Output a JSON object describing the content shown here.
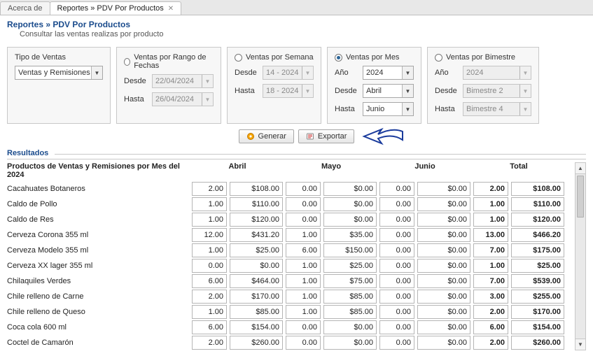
{
  "tabs": {
    "inactive": "Acerca de",
    "active": "Reportes » PDV Por Productos"
  },
  "title": {
    "crumb": "Reportes » PDV Por Productos",
    "sub": "Consultar las ventas realizas por producto"
  },
  "filters": {
    "tipo": {
      "label": "Tipo de Ventas",
      "value": "Ventas y Remisiones"
    },
    "range": {
      "radio": "Ventas por Rango de Fechas",
      "desde_label": "Desde",
      "desde_value": "22/04/2024",
      "hasta_label": "Hasta",
      "hasta_value": "26/04/2024"
    },
    "week": {
      "radio": "Ventas por Semana",
      "desde_label": "Desde",
      "desde_value": "14 - 2024",
      "hasta_label": "Hasta",
      "hasta_value": "18 - 2024"
    },
    "month": {
      "radio": "Ventas por Mes",
      "anio_label": "Año",
      "anio_value": "2024",
      "desde_label": "Desde",
      "desde_value": "Abril",
      "hasta_label": "Hasta",
      "hasta_value": "Junio"
    },
    "bim": {
      "radio": "Ventas por Bimestre",
      "anio_label": "Año",
      "anio_value": "2024",
      "desde_label": "Desde",
      "desde_value": "Bimestre 2",
      "hasta_label": "Hasta",
      "hasta_value": "Bimestre 4"
    }
  },
  "buttons": {
    "generar": "Generar",
    "exportar": "Exportar"
  },
  "results": {
    "legend": "Resultados",
    "header_title": "Productos de Ventas y Remisiones por Mes del 2024",
    "columns": [
      "Abril",
      "Mayo",
      "Junio",
      "Total"
    ],
    "rows": [
      {
        "name": "Cacahuates Botaneros",
        "m": [
          [
            "2.00",
            "$108.00"
          ],
          [
            "0.00",
            "$0.00"
          ],
          [
            "0.00",
            "$0.00"
          ]
        ],
        "tot": [
          "2.00",
          "$108.00"
        ]
      },
      {
        "name": "Caldo de Pollo",
        "m": [
          [
            "1.00",
            "$110.00"
          ],
          [
            "0.00",
            "$0.00"
          ],
          [
            "0.00",
            "$0.00"
          ]
        ],
        "tot": [
          "1.00",
          "$110.00"
        ]
      },
      {
        "name": "Caldo de Res",
        "m": [
          [
            "1.00",
            "$120.00"
          ],
          [
            "0.00",
            "$0.00"
          ],
          [
            "0.00",
            "$0.00"
          ]
        ],
        "tot": [
          "1.00",
          "$120.00"
        ]
      },
      {
        "name": "Cerveza Corona 355 ml",
        "m": [
          [
            "12.00",
            "$431.20"
          ],
          [
            "1.00",
            "$35.00"
          ],
          [
            "0.00",
            "$0.00"
          ]
        ],
        "tot": [
          "13.00",
          "$466.20"
        ]
      },
      {
        "name": "Cerveza Modelo 355 ml",
        "m": [
          [
            "1.00",
            "$25.00"
          ],
          [
            "6.00",
            "$150.00"
          ],
          [
            "0.00",
            "$0.00"
          ]
        ],
        "tot": [
          "7.00",
          "$175.00"
        ]
      },
      {
        "name": "Cerveza XX lager 355 ml",
        "m": [
          [
            "0.00",
            "$0.00"
          ],
          [
            "1.00",
            "$25.00"
          ],
          [
            "0.00",
            "$0.00"
          ]
        ],
        "tot": [
          "1.00",
          "$25.00"
        ]
      },
      {
        "name": "Chilaquiles Verdes",
        "m": [
          [
            "6.00",
            "$464.00"
          ],
          [
            "1.00",
            "$75.00"
          ],
          [
            "0.00",
            "$0.00"
          ]
        ],
        "tot": [
          "7.00",
          "$539.00"
        ]
      },
      {
        "name": "Chile relleno de Carne",
        "m": [
          [
            "2.00",
            "$170.00"
          ],
          [
            "1.00",
            "$85.00"
          ],
          [
            "0.00",
            "$0.00"
          ]
        ],
        "tot": [
          "3.00",
          "$255.00"
        ]
      },
      {
        "name": "Chile relleno de Queso",
        "m": [
          [
            "1.00",
            "$85.00"
          ],
          [
            "1.00",
            "$85.00"
          ],
          [
            "0.00",
            "$0.00"
          ]
        ],
        "tot": [
          "2.00",
          "$170.00"
        ]
      },
      {
        "name": "Coca cola 600 ml",
        "m": [
          [
            "6.00",
            "$154.00"
          ],
          [
            "0.00",
            "$0.00"
          ],
          [
            "0.00",
            "$0.00"
          ]
        ],
        "tot": [
          "6.00",
          "$154.00"
        ]
      },
      {
        "name": "Coctel de Camarón",
        "m": [
          [
            "2.00",
            "$260.00"
          ],
          [
            "0.00",
            "$0.00"
          ],
          [
            "0.00",
            "$0.00"
          ]
        ],
        "tot": [
          "2.00",
          "$260.00"
        ]
      }
    ]
  }
}
